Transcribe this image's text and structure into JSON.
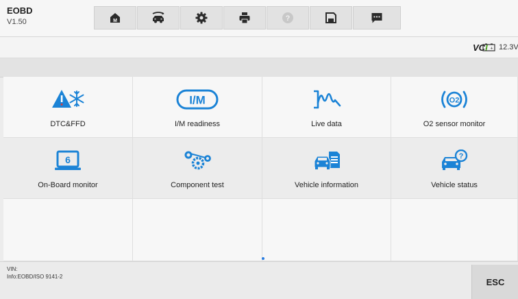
{
  "header": {
    "title": "EOBD",
    "version": "V1.50"
  },
  "toolbar": {
    "buttons": [
      {
        "icon": "home-icon"
      },
      {
        "icon": "vehicle-swap-icon"
      },
      {
        "icon": "gear-icon"
      },
      {
        "icon": "print-icon"
      },
      {
        "icon": "help-icon"
      },
      {
        "icon": "save-icon"
      },
      {
        "icon": "chat-icon"
      }
    ]
  },
  "status": {
    "vci_prefix": "VC",
    "vci_suffix": "I",
    "voltage": "12.3V"
  },
  "functions": [
    {
      "label": "DTC&FFD",
      "icon": "warning-snowflake-icon"
    },
    {
      "label": "I/M readiness",
      "icon": "im-icon"
    },
    {
      "label": "Live data",
      "icon": "waveform-icon"
    },
    {
      "label": "O2 sensor monitor",
      "icon": "o2-sensor-icon"
    },
    {
      "label": "On-Board monitor",
      "icon": "monitor-6-icon"
    },
    {
      "label": "Component test",
      "icon": "gears-icon"
    },
    {
      "label": "Vehicle information",
      "icon": "vehicle-document-icon"
    },
    {
      "label": "Vehicle status",
      "icon": "vehicle-question-icon"
    }
  ],
  "footer": {
    "vin_label": "VIN:",
    "info": "Info:EOBD/ISO 9141-2",
    "esc_label": "ESC"
  },
  "colors": {
    "icon_blue": "#1b83d6",
    "vci_green": "#4caf1e",
    "warning_red": "#e53935"
  }
}
